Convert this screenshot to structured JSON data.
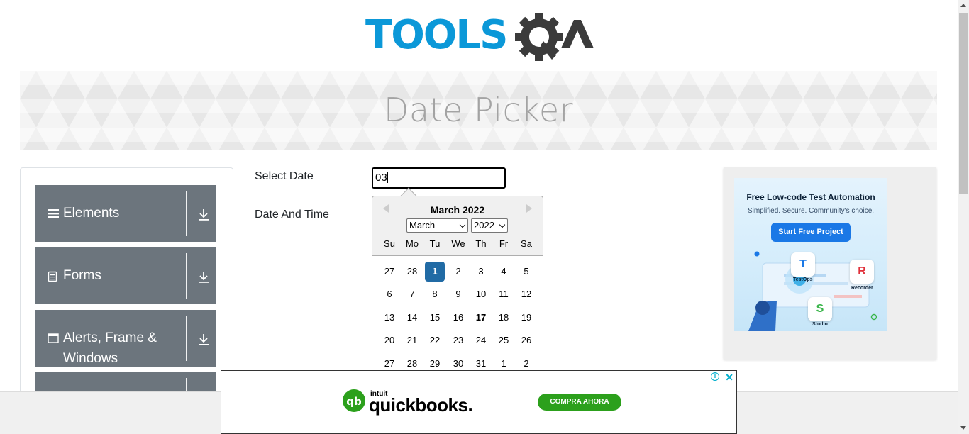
{
  "logo": {
    "text_blue": "TOOLS",
    "text_dark": "QA"
  },
  "banner": {
    "title": "Date Picker"
  },
  "sidebar": {
    "groups": [
      {
        "label": "Elements",
        "icon": "hamburger-icon"
      },
      {
        "label": "Forms",
        "icon": "document-icon"
      },
      {
        "label": "Alerts, Frame &",
        "label2": "Windows",
        "icon": "window-icon"
      },
      {
        "label": "",
        "icon": ""
      }
    ]
  },
  "form": {
    "select_date_label": "Select Date",
    "date_time_label": "Date And Time",
    "date_input_value": "03"
  },
  "datepicker": {
    "month_title": "March 2022",
    "month_select": "March",
    "year_select": "2022",
    "weekdays": [
      "Su",
      "Mo",
      "Tu",
      "We",
      "Th",
      "Fr",
      "Sa"
    ],
    "weeks": [
      [
        "27",
        "28",
        "1",
        "2",
        "3",
        "4",
        "5"
      ],
      [
        "6",
        "7",
        "8",
        "9",
        "10",
        "11",
        "12"
      ],
      [
        "13",
        "14",
        "15",
        "16",
        "17",
        "18",
        "19"
      ],
      [
        "20",
        "21",
        "22",
        "23",
        "24",
        "25",
        "26"
      ],
      [
        "27",
        "28",
        "29",
        "30",
        "31",
        "1",
        "2"
      ]
    ],
    "selected_day": "1",
    "today": "17",
    "selected_color": "#216ba5"
  },
  "ad_side": {
    "title": "Free Low-code Test Automation",
    "subtitle": "Simplified. Secure. Community's choice.",
    "button": "Start Free Project",
    "tiles": [
      "TestOps",
      "Recorder",
      "Studio"
    ]
  },
  "ad_bottom": {
    "brand_small": "intuit",
    "brand": "quickbooks.",
    "cta": "COMPRA AHORA",
    "cta_color": "#2ca01c"
  },
  "colors": {
    "sidebar_bg": "#6c757d",
    "logo_blue": "#0b98d8",
    "logo_dark": "#3b3b3b"
  }
}
